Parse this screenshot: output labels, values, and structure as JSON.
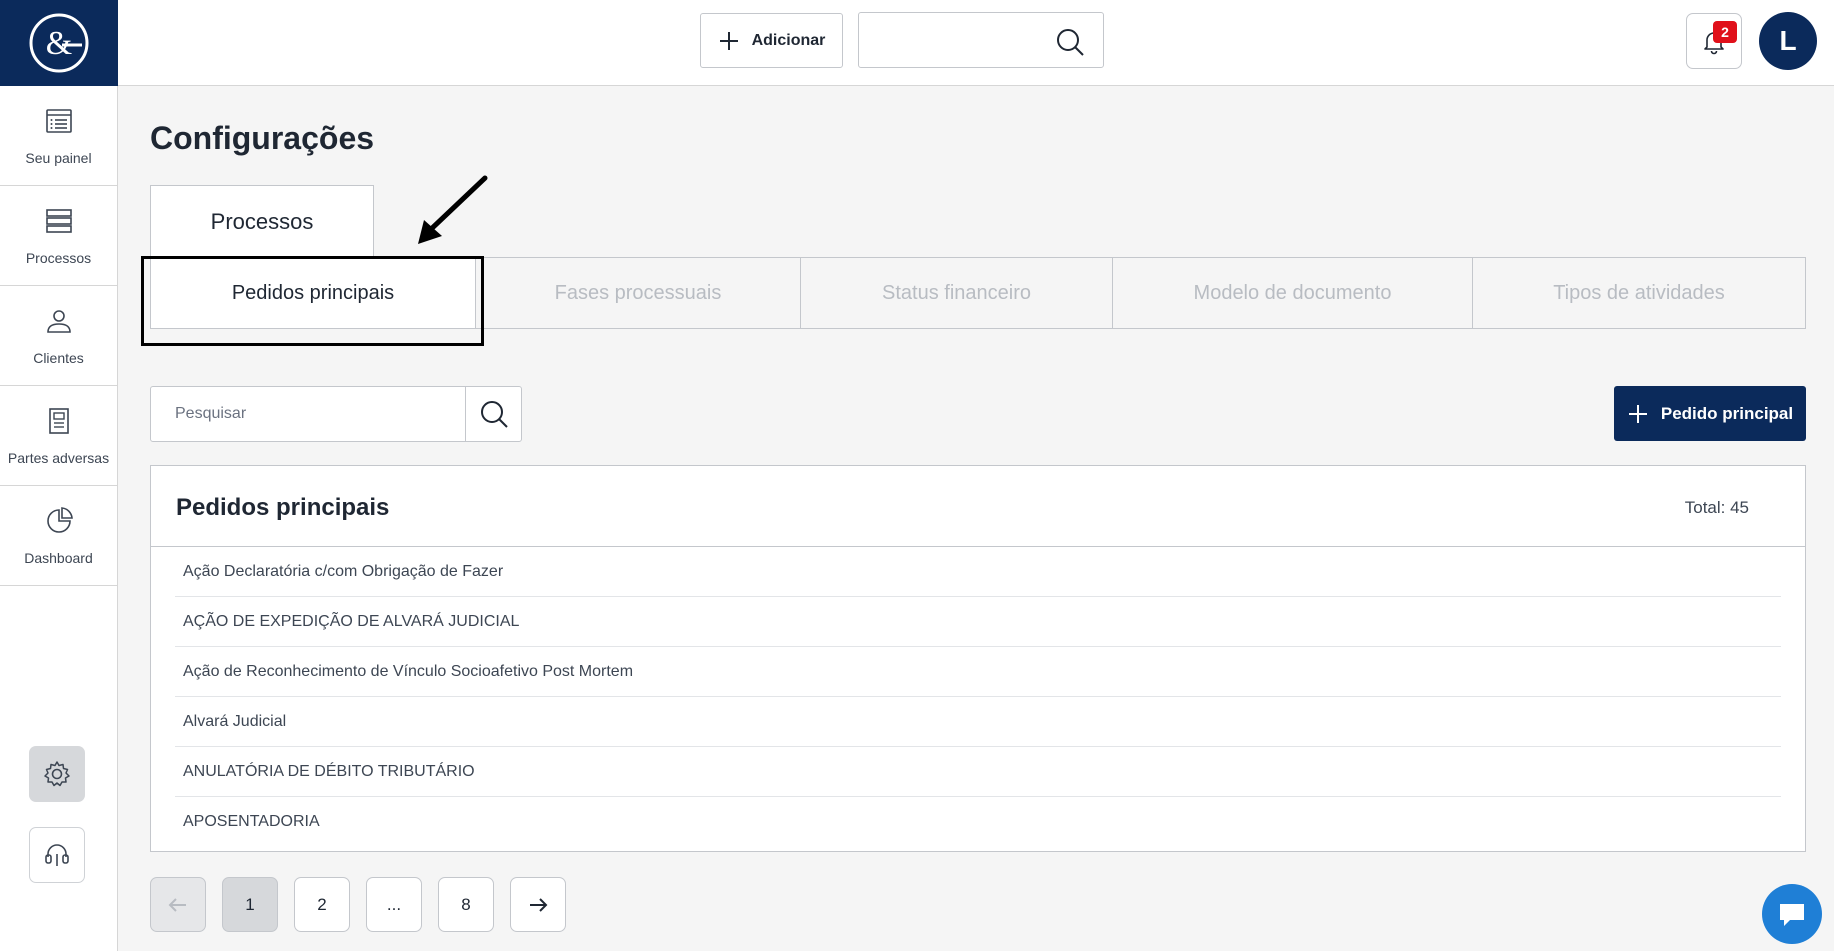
{
  "topbar": {
    "add_label": "Adicionar",
    "search_value": "",
    "notification_count": "2",
    "avatar_initial": "L"
  },
  "sidebar": {
    "items": [
      {
        "label": "Seu painel",
        "icon": "dashboard-list-icon"
      },
      {
        "label": "Processos",
        "icon": "stack-icon"
      },
      {
        "label": "Clientes",
        "icon": "user-icon"
      },
      {
        "label": "Partes adversas",
        "icon": "document-icon"
      },
      {
        "label": "Dashboard",
        "icon": "pie-chart-icon"
      }
    ]
  },
  "page": {
    "title": "Configurações",
    "main_tab": "Processos"
  },
  "subtabs": [
    {
      "label": "Pedidos principais",
      "active": true
    },
    {
      "label": "Fases processuais",
      "active": false
    },
    {
      "label": "Status financeiro",
      "active": false
    },
    {
      "label": "Modelo de documento",
      "active": false
    },
    {
      "label": "Tipos de atividades",
      "active": false
    }
  ],
  "search": {
    "placeholder": "Pesquisar",
    "value": ""
  },
  "actions": {
    "add_primary_label": "Pedido principal"
  },
  "list": {
    "title": "Pedidos principais",
    "total": "Total: 45",
    "items": [
      "Ação Declaratória c/com Obrigação de Fazer",
      "AÇÃO DE EXPEDIÇÃO DE ALVARÁ JUDICIAL",
      "Ação de Reconhecimento de Vínculo Socioafetivo Post Mortem",
      "Alvará Judicial",
      "ANULATÓRIA DE DÉBITO TRIBUTÁRIO",
      "APOSENTADORIA"
    ]
  },
  "pagination": {
    "pages": [
      "1",
      "2",
      "...",
      "8"
    ],
    "current": "1"
  },
  "colors": {
    "brand": "#0b2a5b",
    "badge": "#e0101a",
    "chat": "#1f7fd6"
  }
}
